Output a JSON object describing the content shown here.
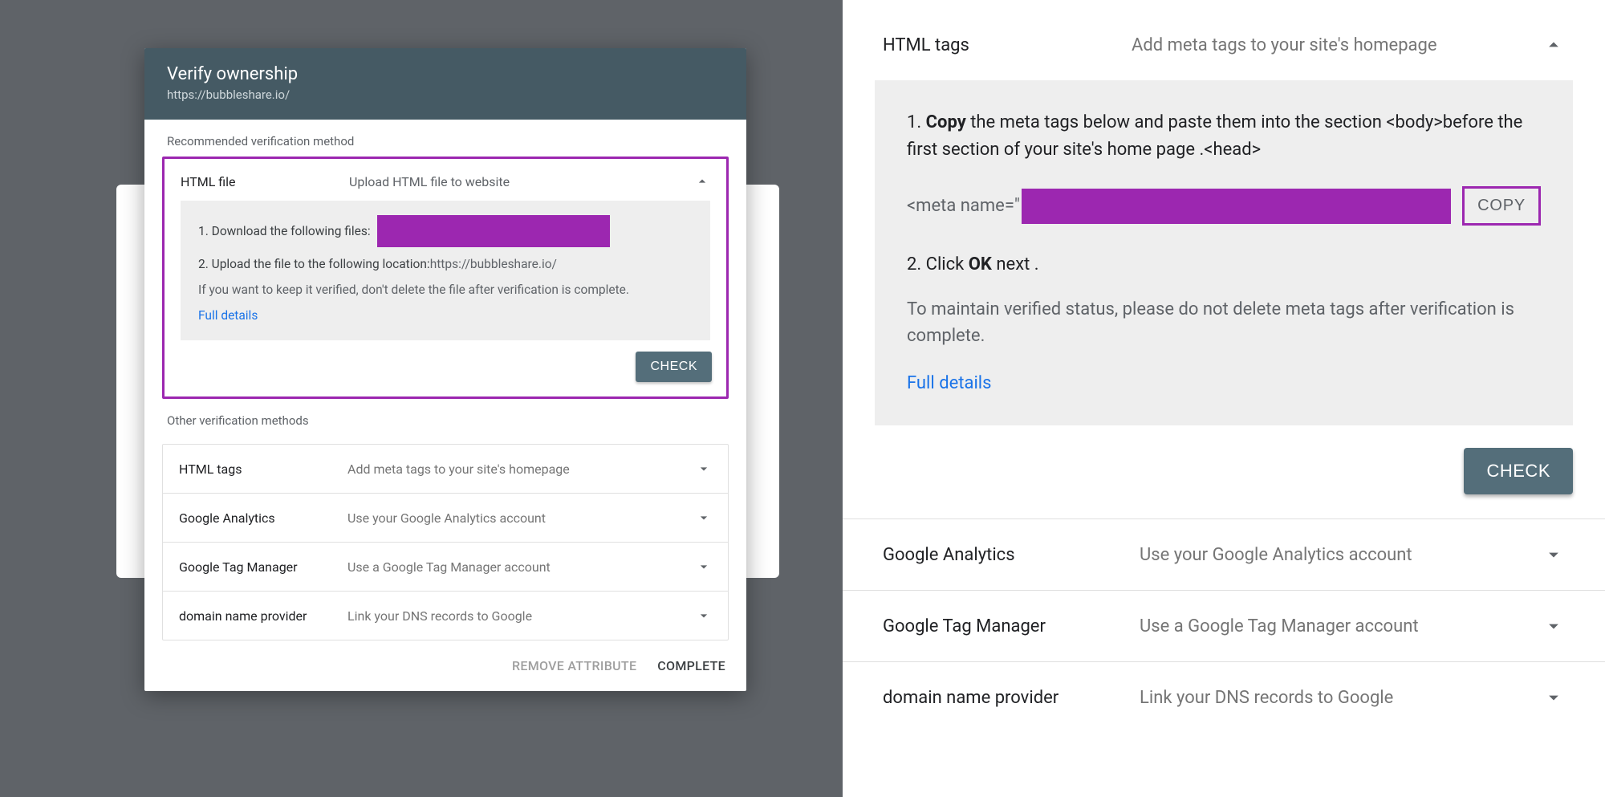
{
  "left": {
    "header": {
      "title": "Verify ownership",
      "subtitle": "https://bubbleshare.io/"
    },
    "recommended_label": "Recommended verification method",
    "html_file": {
      "name": "HTML file",
      "desc": "Upload HTML file to website",
      "step1": "1. Download the following files:",
      "step2_prefix": "2. Upload the file to the following location: ",
      "step2_url": "https://bubbleshare.io/",
      "note": "If you want to keep it verified, don't delete the file after verification is complete.",
      "details": "Full details",
      "check": "CHECK"
    },
    "other_label": "Other verification methods",
    "other": [
      {
        "name": "HTML tags",
        "desc": "Add meta tags to your site's homepage"
      },
      {
        "name": "Google Analytics",
        "desc": "Use your Google Analytics account"
      },
      {
        "name": "Google Tag Manager",
        "desc": "Use a Google Tag Manager account"
      },
      {
        "name": "domain name provider",
        "desc": "Link your DNS records to Google"
      }
    ],
    "footer": {
      "remove": "REMOVE ATTRIBUTE",
      "complete": "COMPLETE"
    }
  },
  "right": {
    "top": {
      "name": "HTML tags",
      "desc": "Add meta tags to your site's homepage"
    },
    "step1_a": "1. ",
    "step1_b": "Copy",
    "step1_c": " the meta tags below and paste them into the section <body>before the first section of your site's home page .<head>",
    "meta_prefix": "<meta name=\"",
    "copy": "COPY",
    "step2_a": "2. Click ",
    "step2_b": "OK",
    "step2_c": " next .",
    "note": "To maintain verified status, please do not delete meta tags after verification is complete.",
    "details": "Full details",
    "check": "CHECK",
    "list": [
      {
        "name": "Google Analytics",
        "desc": "Use your Google Analytics account"
      },
      {
        "name": "Google Tag Manager",
        "desc": "Use a Google Tag Manager account"
      },
      {
        "name": "domain name provider",
        "desc": "Link your DNS records to Google"
      }
    ]
  }
}
